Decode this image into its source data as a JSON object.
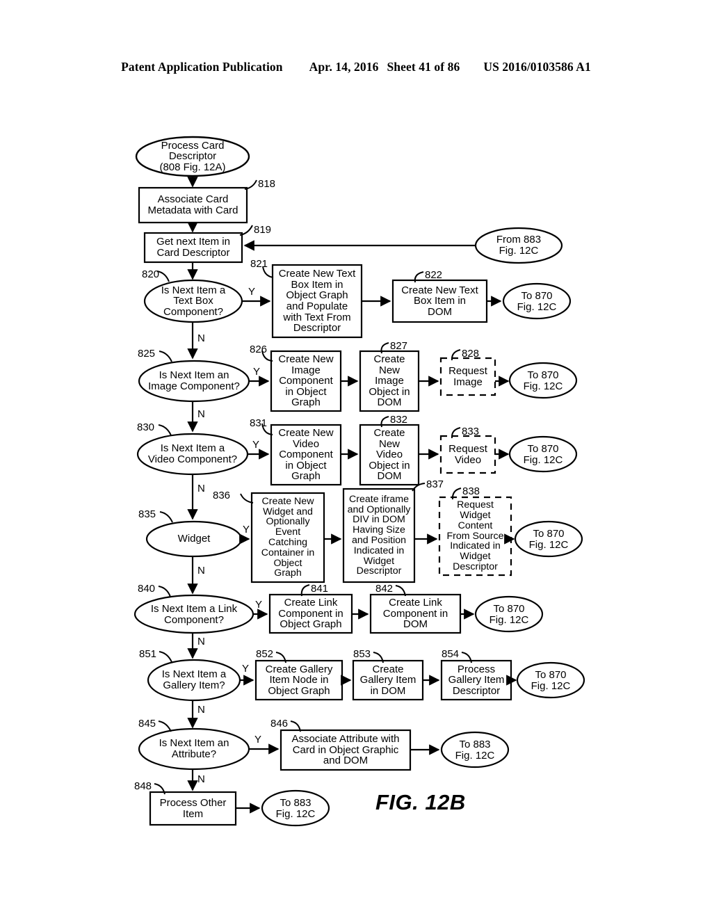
{
  "header": {
    "publication": "Patent Application Publication",
    "date": "Apr. 14, 2016",
    "sheet": "Sheet 41 of 86",
    "docnum": "US 2016/0103586 A1"
  },
  "figure": {
    "caption": "FIG. 12B",
    "nodes": {
      "start": "Process Card\nDescriptor\n(808 Fig. 12A)",
      "n818": "Associate Card\nMetadata with Card",
      "n819": "Get next Item in\nCard Descriptor",
      "from883": "From 883\nFig. 12C",
      "d820": "Is Next Item a\nText Box\nComponent?",
      "n821": "Create New Text\nBox Item in\nObject Graph\nand Populate\nwith Text From\nDescriptor",
      "n822": "Create New Text\nBox Item in\nDOM",
      "to870a": "To 870\nFig. 12C",
      "d825": "Is Next Item an\nImage Component?",
      "n826": "Create New\nImage\nComponent\nin Object\nGraph",
      "n827": "Create\nNew\nImage\nObject in\nDOM",
      "n828": "Request\nImage",
      "to870b": "To 870\nFig. 12C",
      "d830": "Is Next Item a\nVideo Component?",
      "n831": "Create New\nVideo\nComponent\nin Object\nGraph",
      "n832": "Create\nNew\nVideo\nObject in\nDOM",
      "n833": "Request\nVideo",
      "to870c": "To 870\nFig. 12C",
      "d835": "Widget",
      "n836": "Create New\nWidget and\nOptionally\nEvent\nCatching\nContainer in\nObject\nGraph",
      "n837": "Create iframe\nand Optionally\nDIV in DOM\nHaving Size\nand Position\nIndicated in\nWidget\nDescriptor",
      "n838": "Request\nWidget\nContent\nFrom Source\nIndicated in\nWidget\nDescriptor",
      "to870d": "To 870\nFig. 12C",
      "d840": "Is Next Item a Link\nComponent?",
      "n841": "Create Link\nComponent in\nObject Graph",
      "n842": "Create Link\nComponent in\nDOM",
      "to870e": "To 870\nFig. 12C",
      "d851": "Is Next Item a\nGallery Item?",
      "n852": "Create Gallery\nItem Node in\nObject Graph",
      "n853": "Create\nGallery Item\nin DOM",
      "n854": "Process\nGallery Item\nDescriptor",
      "to870f": "To 870\nFig. 12C",
      "d845": "Is Next Item an\nAttribute?",
      "n846": "Associate Attribute with\nCard in Object Graphic\nand DOM",
      "to883a": "To 883\nFig. 12C",
      "n848": "Process Other\nItem",
      "to883b": "To 883\nFig. 12C"
    },
    "refnums": {
      "r818": "818",
      "r819": "819",
      "r820": "820",
      "r821": "821",
      "r822": "822",
      "r825": "825",
      "r826": "826",
      "r827": "827",
      "r828": "828",
      "r830": "830",
      "r831": "831",
      "r832": "832",
      "r833": "833",
      "r835": "835",
      "r836": "836",
      "r837": "837",
      "r838": "838",
      "r840": "840",
      "r841": "841",
      "r842": "842",
      "r845": "845",
      "r846": "846",
      "r848": "848",
      "r851": "851",
      "r852": "852",
      "r853": "853",
      "r854": "854"
    },
    "branch_labels": {
      "y820": "Y",
      "n820": "N",
      "y825": "Y",
      "n825": "N",
      "y830": "Y",
      "n830": "N",
      "y835": "Y",
      "n835": "N",
      "y840": "Y",
      "n840": "N",
      "y851": "Y",
      "n851": "N",
      "y845": "Y",
      "n845": "N"
    },
    "colors": {
      "stroke": "#000000",
      "background": "#ffffff"
    }
  }
}
